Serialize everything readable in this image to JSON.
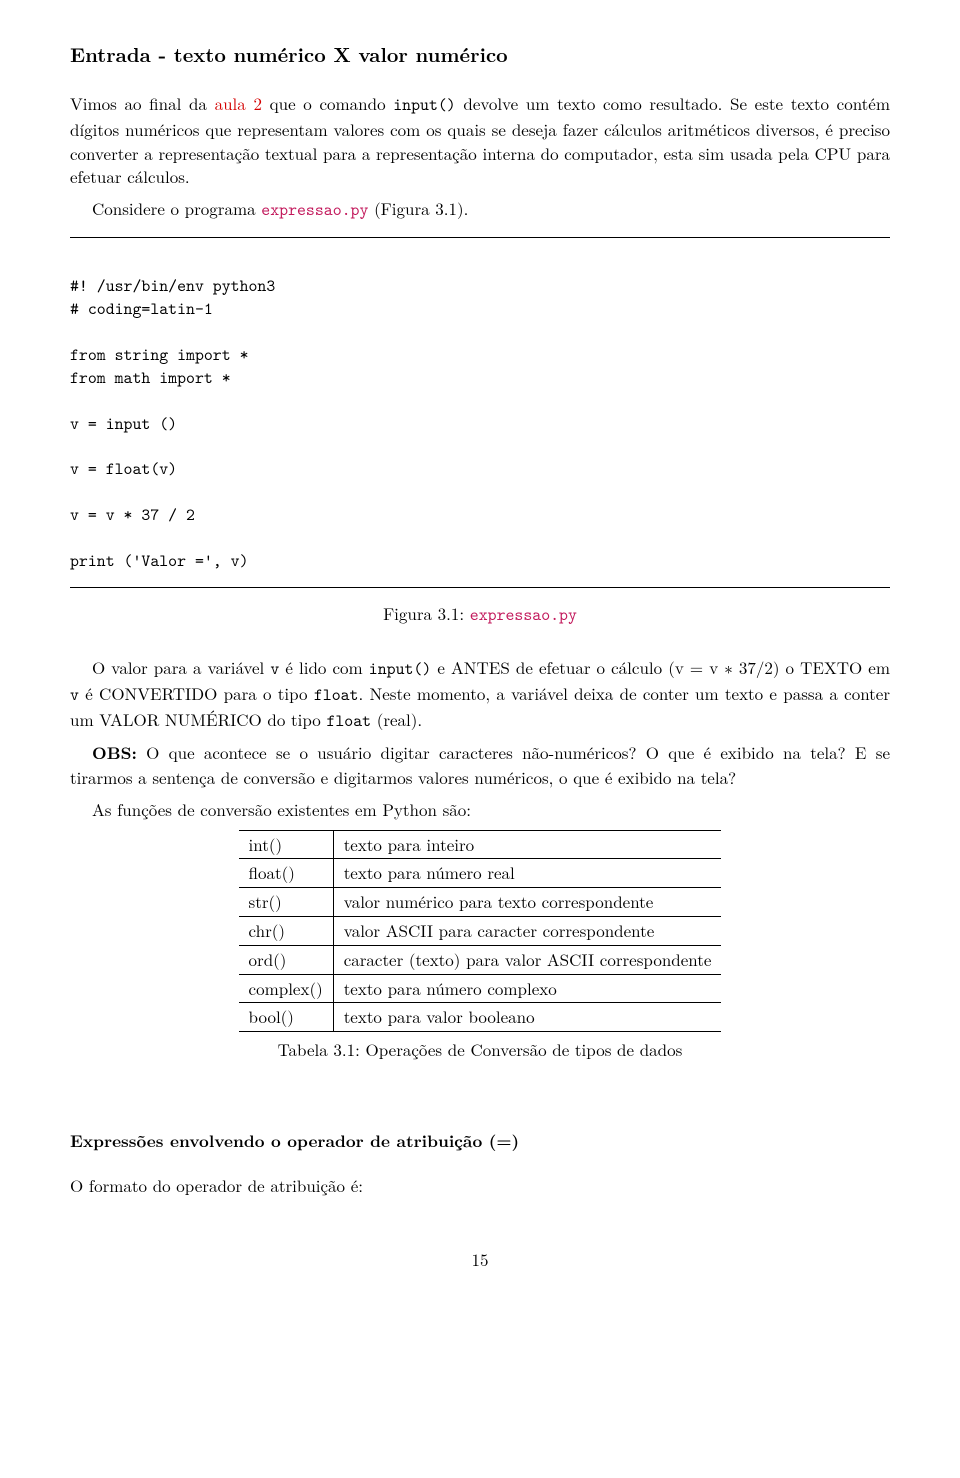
{
  "heading": "Entrada - texto numérico X valor numérico",
  "p1a": "Vimos ao final da ",
  "p1link": "aula 2",
  "p1b": " que o comando ",
  "p1tt": "input()",
  "p1c": " devolve um texto como resultado. Se este texto contém dígitos numéricos que representam valores com os quais se deseja fazer cálculos aritméticos diversos, é preciso converter a representação textual para a representação interna do computador, esta sim usada pela CPU para efetuar cálculos.",
  "p2a": "Considere o programa ",
  "p2code": "expressao.py",
  "p2b": " (Figura 3.1).",
  "code": {
    "l1": "#! /usr/bin/env python3",
    "l2": "# coding=latin-1",
    "l3": "from string import *",
    "l4": "from math import *",
    "l5": "v = input ()",
    "l6": "v = float(v)",
    "l7": "v = v * 37 / 2",
    "l8": "print ('Valor =', v)"
  },
  "fig_caption_a": "Figura 3.1: ",
  "fig_caption_code": "expressao.py",
  "p3a": "O valor para a variável ",
  "p3tt1": "v",
  "p3b": " é lido com ",
  "p3tt2": "input()",
  "p3c": " e ANTES de efetuar o cálculo (v = v ∗ 37/2) o TEXTO em ",
  "p3tt3": "v",
  "p3d": " é CONVERTIDO para o tipo ",
  "p3tt4": "float",
  "p3e": ". Neste momento, a variável deixa de conter um texto e passa a conter um VALOR NUMÉRICO do tipo ",
  "p3tt5": "float",
  "p3f": " (real).",
  "p4a": "OBS:",
  "p4b": " O que acontece se o usuário digitar caracteres não-numéricos? O que é exibido na tela? E se tirarmos a sentença de conversão e digitarmos valores numéricos, o que é exibido na tela?",
  "p5": "As funções de conversão existentes em Python são:",
  "table": [
    {
      "fn": "int()",
      "desc": "texto para inteiro"
    },
    {
      "fn": "float()",
      "desc": "texto para número real"
    },
    {
      "fn": "str()",
      "desc": "valor numérico para texto correspondente"
    },
    {
      "fn": "chr()",
      "desc": "valor ASCII para caracter correspondente"
    },
    {
      "fn": "ord()",
      "desc": "caracter (texto) para valor ASCII correspondente"
    },
    {
      "fn": "complex()",
      "desc": "texto para número complexo"
    },
    {
      "fn": "bool()",
      "desc": "texto para valor booleano"
    }
  ],
  "table_caption": "Tabela 3.1: Operações de Conversão de tipos de dados",
  "subheading": "Expressões envolvendo o operador de atribuição (=)",
  "p6": "O formato do operador de atribuição é:",
  "page": "15"
}
